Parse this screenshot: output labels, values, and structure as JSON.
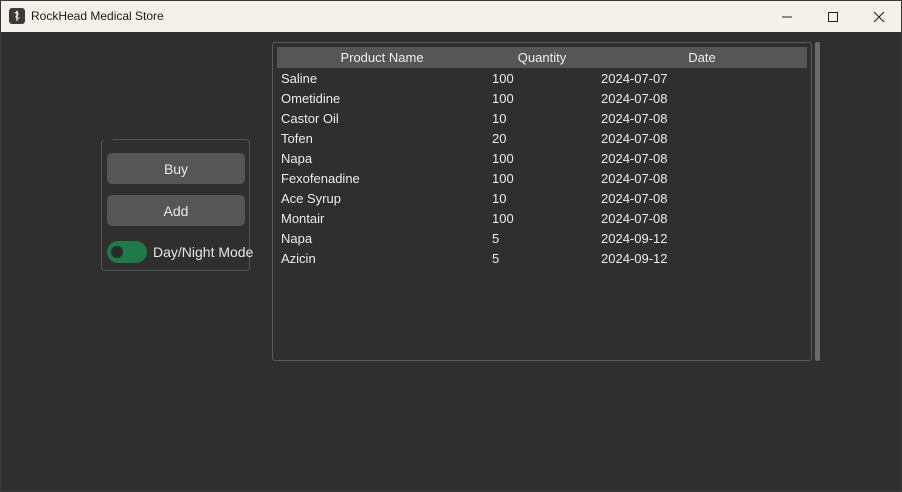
{
  "window": {
    "title": "RockHead Medical Store",
    "icon": "app-logo-icon",
    "controls": {
      "minimize_icon": "minimize-icon",
      "maximize_icon": "maximize-icon",
      "close_icon": "close-icon"
    }
  },
  "panel": {
    "buy_label": "Buy",
    "add_label": "Add",
    "toggle_label": "Day/Night Mode",
    "toggle_on": true,
    "toggle_color": "#1f7a4a"
  },
  "table": {
    "columns": [
      "Product Name",
      "Quantity",
      "Date"
    ],
    "rows": [
      [
        "Saline",
        "100",
        "2024-07-07"
      ],
      [
        "Ometidine",
        "100",
        "2024-07-08"
      ],
      [
        "Castor Oil",
        "10",
        "2024-07-08"
      ],
      [
        "Tofen",
        "20",
        "2024-07-08"
      ],
      [
        "Napa",
        "100",
        "2024-07-08"
      ],
      [
        "Fexofenadine",
        "100",
        "2024-07-08"
      ],
      [
        "Ace Syrup",
        "10",
        "2024-07-08"
      ],
      [
        "Montair",
        "100",
        "2024-07-08"
      ],
      [
        "Napa",
        "5",
        "2024-09-12"
      ],
      [
        "Azicin",
        "5",
        "2024-09-12"
      ]
    ]
  },
  "colors": {
    "background": "#2f2f2f",
    "titlebar": "#f4f1ea",
    "button": "#565656",
    "header": "#565656"
  }
}
